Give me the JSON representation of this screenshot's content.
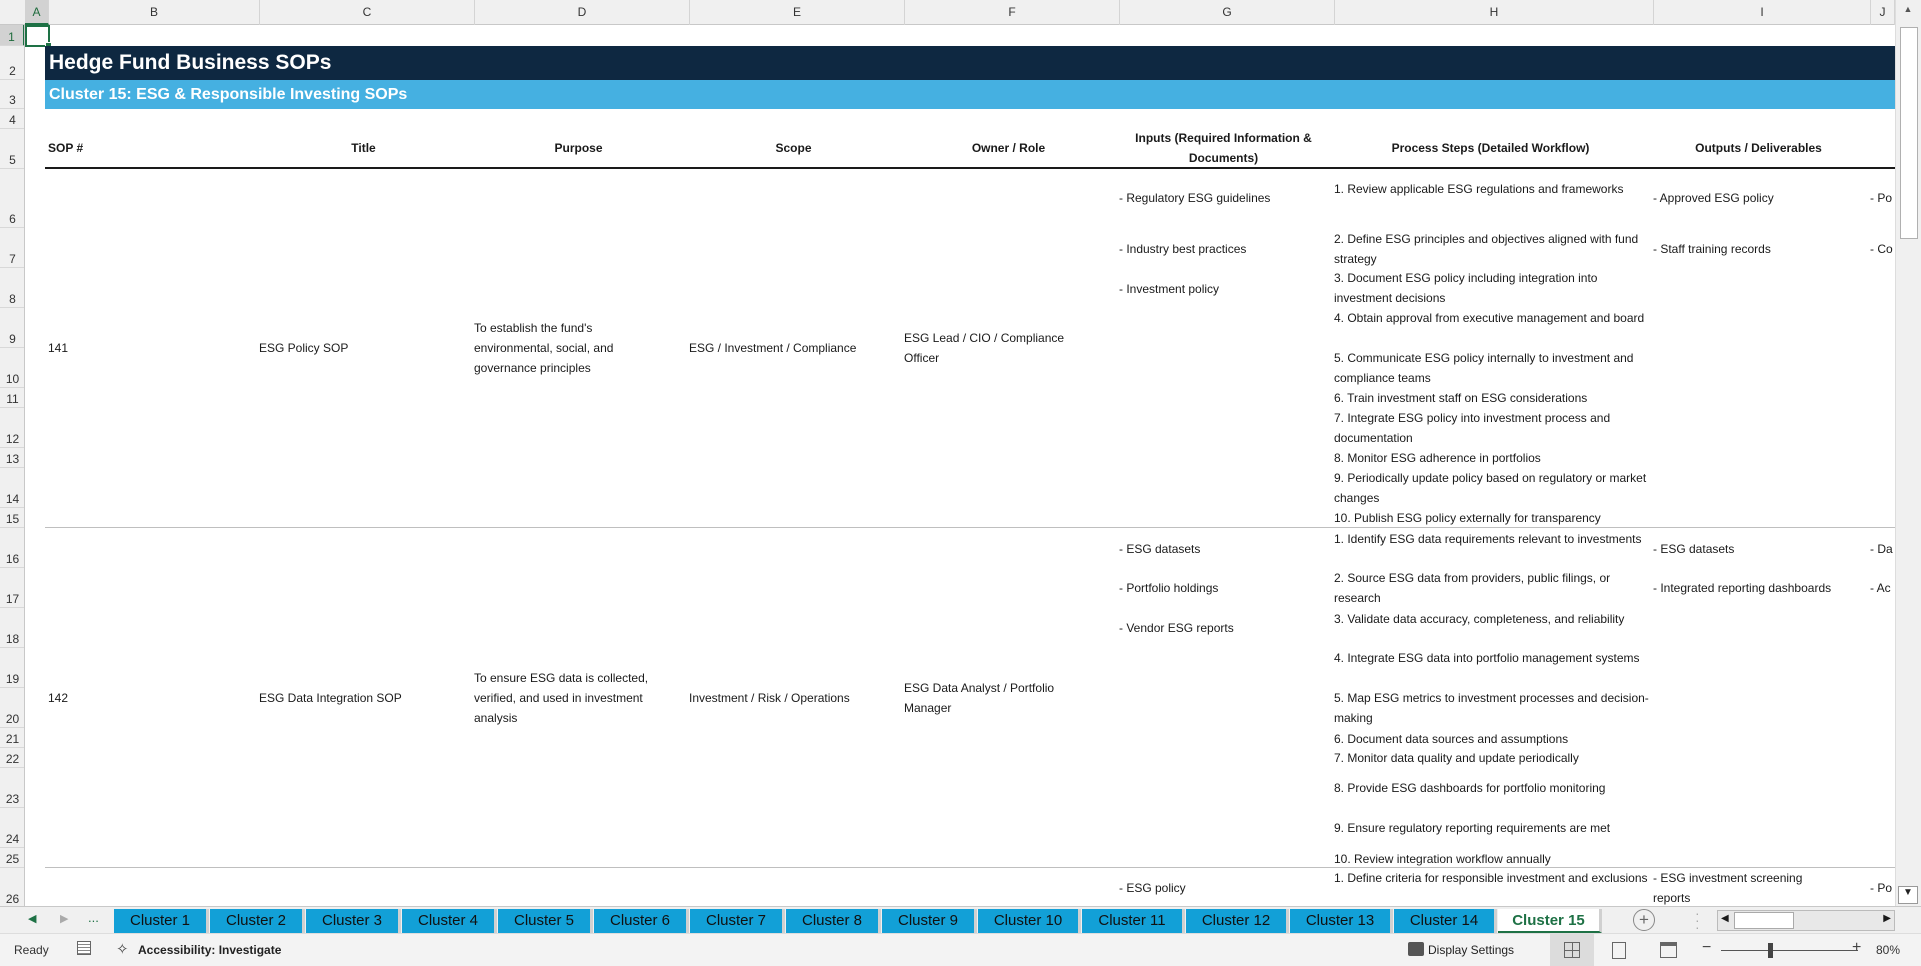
{
  "grid": {
    "columns": [
      "A",
      "B",
      "C",
      "D",
      "E",
      "F",
      "G",
      "H",
      "I",
      "J"
    ],
    "rows": [
      "1",
      "2",
      "3",
      "4",
      "5",
      "6",
      "7",
      "8",
      "9",
      "10",
      "11",
      "12",
      "13",
      "14",
      "15",
      "16",
      "17",
      "18",
      "19",
      "20",
      "21",
      "22",
      "23",
      "24",
      "25",
      "26"
    ]
  },
  "sheet": {
    "title": "Hedge Fund Business SOPs",
    "subtitle": "Cluster 15: ESG & Responsible Investing SOPs",
    "headers": {
      "sop": "SOP #",
      "title": "Title",
      "purpose": "Purpose",
      "scope": "Scope",
      "owner": "Owner / Role",
      "inputs": "Inputs (Required Information & Documents)",
      "steps": "Process Steps (Detailed Workflow)",
      "outputs": "Outputs / Deliverables"
    },
    "sops": [
      {
        "num": "141",
        "title": "ESG Policy SOP",
        "purpose": "To establish the fund's environmental, social, and governance principles",
        "scope": "ESG / Investment / Compliance",
        "owner": "ESG Lead / CIO / Compliance Officer",
        "inputs": [
          "- Regulatory ESG guidelines",
          "- Industry best practices",
          "- Investment policy"
        ],
        "steps": [
          "1. Review applicable ESG regulations and frameworks",
          "2. Define ESG principles and objectives aligned with fund strategy",
          "3. Document ESG policy including integration into investment decisions",
          "4. Obtain approval from executive management and board",
          "5. Communicate ESG policy internally to investment and compliance teams",
          "6. Train investment staff on ESG considerations",
          "7. Integrate ESG policy into investment process and documentation",
          "8. Monitor ESG adherence in portfolios",
          "9. Periodically update policy based on regulatory or market changes",
          "10. Publish ESG policy externally for transparency"
        ],
        "outputs": [
          "- Approved ESG policy",
          "- Staff training records"
        ],
        "next_col": [
          "- Po",
          "- Co"
        ]
      },
      {
        "num": "142",
        "title": "ESG Data Integration SOP",
        "purpose": "To ensure ESG data is collected, verified, and used in investment analysis",
        "scope": "Investment / Risk / Operations",
        "owner": "ESG Data Analyst / Portfolio Manager",
        "inputs": [
          "- ESG datasets",
          "- Portfolio holdings",
          "- Vendor ESG reports"
        ],
        "steps": [
          "1. Identify ESG data requirements relevant to investments",
          "2. Source ESG data from providers, public filings, or research",
          "3. Validate data accuracy, completeness, and reliability",
          "4. Integrate ESG data into portfolio management systems",
          "5. Map ESG metrics to investment processes and decision-making",
          "6. Document data sources and assumptions",
          "7. Monitor data quality and update periodically",
          "8. Provide ESG dashboards for portfolio monitoring",
          "9. Ensure regulatory reporting requirements are met",
          "10. Review integration workflow annually"
        ],
        "outputs": [
          "- ESG datasets",
          "- Integrated reporting dashboards"
        ],
        "next_col": [
          "- Da",
          "- Ac"
        ]
      },
      {
        "inputs": [
          "- ESG policy"
        ],
        "steps": [
          "1. Define criteria for responsible investment and exclusions"
        ],
        "outputs": [
          "- ESG investment screening reports"
        ],
        "next_col": [
          "- Po"
        ]
      }
    ]
  },
  "tabs": {
    "ellipsis": "...",
    "items": [
      "Cluster 1",
      "Cluster 2",
      "Cluster 3",
      "Cluster 4",
      "Cluster 5",
      "Cluster 6",
      "Cluster 7",
      "Cluster 8",
      "Cluster 9",
      "Cluster 10",
      "Cluster 11",
      "Cluster 12",
      "Cluster 13",
      "Cluster 14",
      "Cluster 15"
    ],
    "active": "Cluster 15"
  },
  "status": {
    "ready": "Ready",
    "accessibility": "Accessibility: Investigate",
    "display_settings": "Display Settings",
    "zoom": "80%",
    "zoom_percent": 80
  }
}
